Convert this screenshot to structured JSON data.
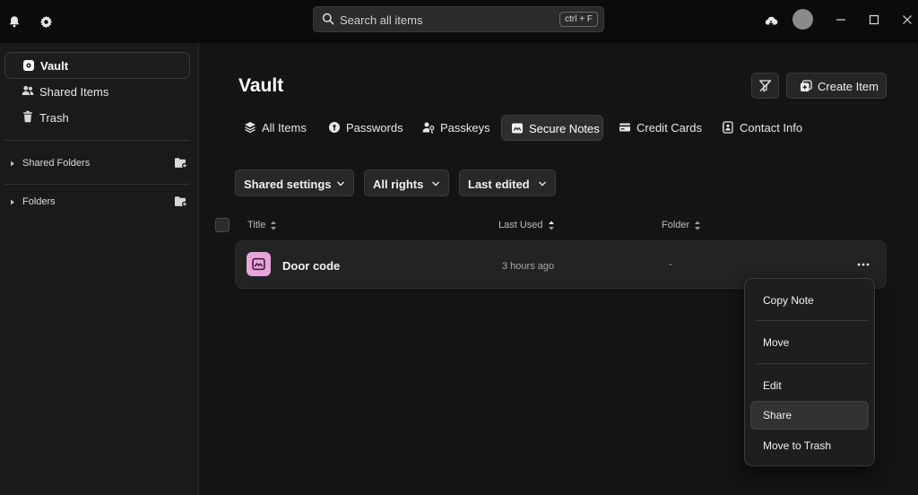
{
  "search": {
    "placeholder": "Search all items",
    "shortcut": "ctrl + F"
  },
  "sidebar": {
    "items": [
      {
        "label": "Vault",
        "active": true
      },
      {
        "label": "Shared Items",
        "active": false
      },
      {
        "label": "Trash",
        "active": false
      }
    ],
    "groups": [
      {
        "label": "Shared Folders"
      },
      {
        "label": "Folders"
      }
    ]
  },
  "main": {
    "title": "Vault",
    "create_label": "Create Item",
    "tabs": [
      {
        "label": "All Items",
        "icon": "layers-icon",
        "active": false
      },
      {
        "label": "Passwords",
        "icon": "password-icon",
        "active": false
      },
      {
        "label": "Passkeys",
        "icon": "passkey-icon",
        "active": false
      },
      {
        "label": "Secure Notes",
        "icon": "note-icon",
        "active": true
      },
      {
        "label": "Credit Cards",
        "icon": "card-icon",
        "active": false
      },
      {
        "label": "Contact Info",
        "icon": "contact-icon",
        "active": false
      }
    ],
    "filters": [
      {
        "label": "Shared settings"
      },
      {
        "label": "All rights"
      },
      {
        "label": "Last edited"
      }
    ],
    "columns": {
      "title": "Title",
      "last_used": "Last Used",
      "folder": "Folder"
    },
    "rows": [
      {
        "title": "Door code",
        "last_used": "3 hours ago",
        "folder": "-"
      }
    ]
  },
  "context_menu": {
    "items": [
      "Copy Note",
      "Move",
      "Edit",
      "Share",
      "Move to Trash"
    ],
    "highlighted": "Share"
  },
  "colors": {
    "background": "#141414",
    "sidebar": "#1a1a1a",
    "note_accent": "#e7a5dc"
  }
}
